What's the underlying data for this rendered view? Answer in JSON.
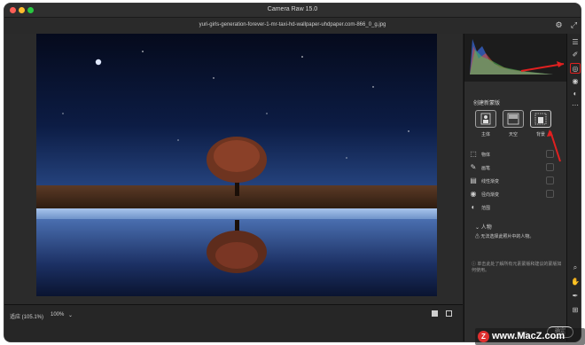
{
  "window": {
    "title": "Camera Raw 15.0",
    "filename": "yuri-girls-generation-forever-1-mr-taxi-hd-wallpaper-uhdpaper.com-866_0_g.jpg"
  },
  "bottom": {
    "fit_label": "适应 (105.1%)",
    "zoom_value": "100%"
  },
  "panel": {
    "mask_title": "创建新蒙版",
    "mask_buttons": [
      "主体",
      "天空",
      "背景"
    ],
    "tools": [
      "物体",
      "画笔",
      "线性渐变",
      "径向渐变",
      "范围"
    ],
    "person_heading": "人物",
    "person_warning": "无法选择此照片中的人物。",
    "info_text": "单击此处了解所有元素蒙版和建议的蒙版如何使用。"
  },
  "footer": {
    "cancel_label": "取消",
    "done_label": "确定"
  },
  "watermark": {
    "logo": "Z",
    "text": "www.MacZ.com"
  },
  "colors": {
    "accent_arrow": "#e02020",
    "background": "#1e1e1e"
  }
}
